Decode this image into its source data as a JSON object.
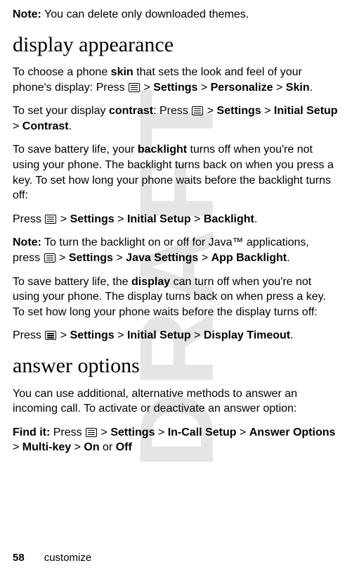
{
  "watermark": "DRAFT",
  "note1": {
    "label": "Note:",
    "text": " You can delete only downloaded themes."
  },
  "h_display": "display appearance",
  "p_skin": {
    "t1": "To choose a phone ",
    "b1": "skin",
    "t2": " that sets the look and feel of your phone's display: Press ",
    "gt1": " > ",
    "m1": "Settings",
    "gt2": " > ",
    "m2": "Personalize",
    "gt3": " > ",
    "m3": "Skin",
    "dot": "."
  },
  "p_contrast": {
    "t1": "To set your display ",
    "b1": "contrast",
    "t2": ": Press ",
    "gt1": " > ",
    "m1": "Settings",
    "gt2": " > ",
    "m2": "Initial Setup",
    "gt3": " > ",
    "m3": "Contrast",
    "dot": "."
  },
  "p_backlight_intro": {
    "t1": "To save battery life, your ",
    "b1": "backlight",
    "t2": " turns off when you're not using your phone. The backlight turns back on when you press a key. To set how long your phone waits before the backlight turns off:"
  },
  "p_backlight_path": {
    "t1": "Press ",
    "gt1": " > ",
    "m1": "Settings",
    "gt2": " > ",
    "m2": "Initial Setup",
    "gt3": " > ",
    "m3": "Backlight",
    "dot": "."
  },
  "note2": {
    "label": "Note:",
    "t1": " To turn the backlight on or off for Java™ applications, press ",
    "gt1": " > ",
    "m1": "Settings",
    "gt2": " > ",
    "m2": "Java Settings",
    "gt3": " > ",
    "m3": "App Backlight",
    "dot": "."
  },
  "p_display_intro": {
    "t1": "To save battery life, the ",
    "b1": "display",
    "t2": " can turn off when you're not using your phone. The display turns back on when press a key. To set how long your phone waits before the display turns off:"
  },
  "p_display_path": {
    "t1": "Press ",
    "gt1": " > ",
    "m1": "Settings",
    "gt2": " > ",
    "m2": "Initial Setup",
    "gt3": " > ",
    "m3": "Display Timeout",
    "dot": "."
  },
  "h_answer": "answer options",
  "p_answer_intro": "You can use additional, alternative methods to answer an incoming call. To activate or deactivate an answer option:",
  "p_findit": {
    "label": "Find it:",
    "t1": " Press ",
    "gt1": " > ",
    "m1": "Settings",
    "gt2": " > ",
    "m2": "In-Call Setup",
    "gt3": " > ",
    "m3": "Answer Options",
    "gt4": " > ",
    "m4": "Multi-key",
    "gt5": " > ",
    "m5": "On",
    "or": " or ",
    "m6": "Off"
  },
  "footer": {
    "page": "58",
    "section": "customize"
  }
}
